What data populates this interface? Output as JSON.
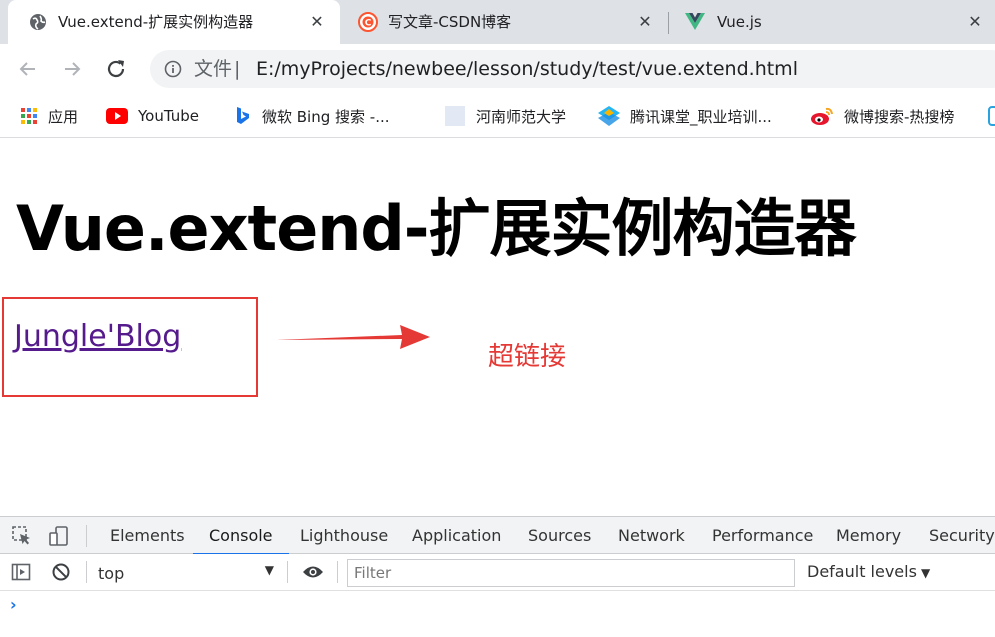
{
  "tabs": [
    {
      "title": "Vue.extend-扩展实例构造器",
      "close": "✕",
      "favicon": "globe-icon"
    },
    {
      "title": "写文章-CSDN博客",
      "close": "✕",
      "favicon": "csdn-icon"
    },
    {
      "title": "Vue.js",
      "close": "✕",
      "favicon": "vue-icon"
    }
  ],
  "toolbar": {
    "security_label": "文件",
    "divider": "|",
    "url": "E:/myProjects/newbee/lesson/study/test/vue.extend.html"
  },
  "bookmarks": [
    {
      "label": "应用",
      "icon": "apps-grid-icon"
    },
    {
      "label": "YouTube",
      "icon": "youtube-icon"
    },
    {
      "label": "微软 Bing 搜索 -...",
      "icon": "bing-icon"
    },
    {
      "label": "河南师范大学",
      "icon": "blank-page-icon"
    },
    {
      "label": "腾讯课堂_职业培训...",
      "icon": "tencent-classroom-icon"
    },
    {
      "label": "微博搜索-热搜榜",
      "icon": "weibo-icon"
    }
  ],
  "page": {
    "heading": "Vue.extend-扩展实例构造器",
    "link_text": "Jungle'Blog",
    "annotation": "超链接"
  },
  "devtools": {
    "tabs": [
      "Elements",
      "Console",
      "Lighthouse",
      "Application",
      "Sources",
      "Network",
      "Performance",
      "Memory",
      "Security"
    ],
    "active_tab": "Console",
    "context": "top",
    "filter_placeholder": "Filter",
    "levels": "Default levels",
    "prompt": "›"
  },
  "colors": {
    "annotation_red": "#e53935",
    "visited_link": "#551a8b",
    "tab_strip": "#dee1e6",
    "active_devtools_tab": "#1a73e8"
  }
}
